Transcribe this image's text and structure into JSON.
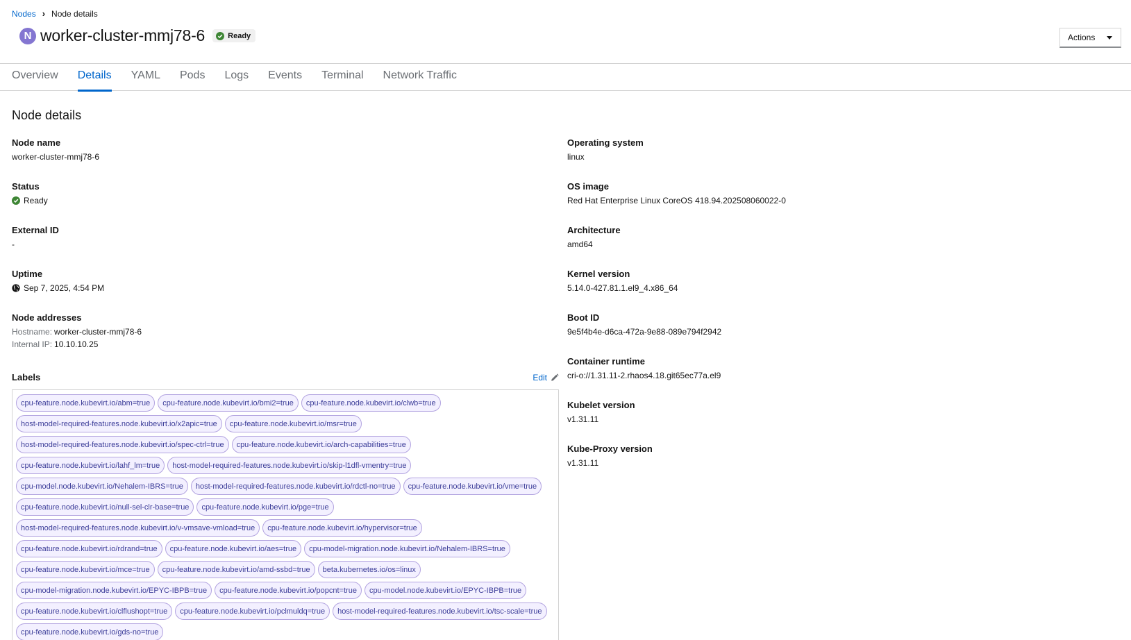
{
  "breadcrumb": {
    "parent": "Nodes",
    "current": "Node details"
  },
  "header": {
    "badge": "N",
    "title": "worker-cluster-mmj78-6",
    "status": "Ready",
    "actions_label": "Actions"
  },
  "tabs": [
    "Overview",
    "Details",
    "YAML",
    "Pods",
    "Logs",
    "Events",
    "Terminal",
    "Network Traffic"
  ],
  "active_tab": "Details",
  "section_title": "Node details",
  "left": {
    "node_name": {
      "label": "Node name",
      "value": "worker-cluster-mmj78-6"
    },
    "status": {
      "label": "Status",
      "value": "Ready"
    },
    "external_id": {
      "label": "External ID",
      "value": "-"
    },
    "uptime": {
      "label": "Uptime",
      "value": "Sep 7, 2025, 4:54 PM"
    },
    "addresses": {
      "label": "Node addresses",
      "hostname_key": "Hostname:",
      "hostname": "worker-cluster-mmj78-6",
      "ip_key": "Internal IP:",
      "ip": "10.10.10.25"
    }
  },
  "right": {
    "os": {
      "label": "Operating system",
      "value": "linux"
    },
    "os_image": {
      "label": "OS image",
      "value": "Red Hat Enterprise Linux CoreOS 418.94.202508060022-0"
    },
    "arch": {
      "label": "Architecture",
      "value": "amd64"
    },
    "kernel": {
      "label": "Kernel version",
      "value": "5.14.0-427.81.1.el9_4.x86_64"
    },
    "boot_id": {
      "label": "Boot ID",
      "value": "9e5f4b4e-d6ca-472a-9e88-089e794f2942"
    },
    "runtime": {
      "label": "Container runtime",
      "value": "cri-o://1.31.11-2.rhaos4.18.git65ec77a.el9"
    },
    "kubelet": {
      "label": "Kubelet version",
      "value": "v1.31.11"
    },
    "kubeproxy": {
      "label": "Kube-Proxy version",
      "value": "v1.31.11"
    }
  },
  "labels_section": {
    "title": "Labels",
    "edit_label": "Edit"
  },
  "labels": [
    "cpu-feature.node.kubevirt.io/abm=true",
    "cpu-feature.node.kubevirt.io/bmi2=true",
    "cpu-feature.node.kubevirt.io/clwb=true",
    "host-model-required-features.node.kubevirt.io/x2apic=true",
    "cpu-feature.node.kubevirt.io/msr=true",
    "host-model-required-features.node.kubevirt.io/spec-ctrl=true",
    "cpu-feature.node.kubevirt.io/arch-capabilities=true",
    "cpu-feature.node.kubevirt.io/lahf_lm=true",
    "host-model-required-features.node.kubevirt.io/skip-l1dfl-vmentry=true",
    "cpu-model.node.kubevirt.io/Nehalem-IBRS=true",
    "host-model-required-features.node.kubevirt.io/rdctl-no=true",
    "cpu-feature.node.kubevirt.io/vme=true",
    "cpu-feature.node.kubevirt.io/null-sel-clr-base=true",
    "cpu-feature.node.kubevirt.io/pge=true",
    "host-model-required-features.node.kubevirt.io/v-vmsave-vmload=true",
    "cpu-feature.node.kubevirt.io/hypervisor=true",
    "cpu-feature.node.kubevirt.io/rdrand=true",
    "cpu-feature.node.kubevirt.io/aes=true",
    "cpu-model-migration.node.kubevirt.io/Nehalem-IBRS=true",
    "cpu-feature.node.kubevirt.io/mce=true",
    "cpu-feature.node.kubevirt.io/amd-ssbd=true",
    "beta.kubernetes.io/os=linux",
    "cpu-model-migration.node.kubevirt.io/EPYC-IBPB=true",
    "cpu-feature.node.kubevirt.io/popcnt=true",
    "cpu-model.node.kubevirt.io/EPYC-IBPB=true",
    "cpu-feature.node.kubevirt.io/clflushopt=true",
    "cpu-feature.node.kubevirt.io/pclmuldq=true",
    "host-model-required-features.node.kubevirt.io/tsc-scale=true",
    "cpu-feature.node.kubevirt.io/gds-no=true"
  ]
}
